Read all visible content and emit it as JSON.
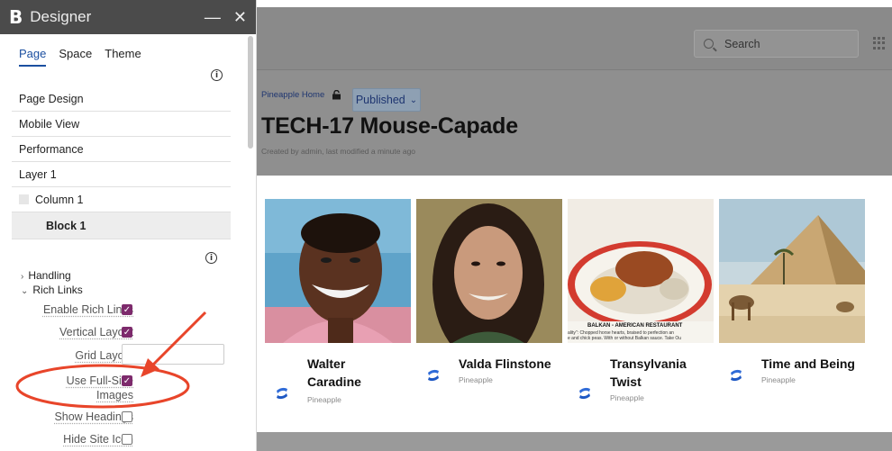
{
  "panel": {
    "title": "Designer",
    "logo": "B",
    "minimize_icon": "—",
    "close_icon": "✕",
    "tabs": [
      {
        "label": "Page",
        "active": true
      },
      {
        "label": "Space",
        "active": false
      },
      {
        "label": "Theme",
        "active": false
      }
    ],
    "info": "i",
    "items": [
      {
        "label": "Page Design"
      },
      {
        "label": "Mobile View"
      },
      {
        "label": "Performance"
      },
      {
        "label": "Layer 1"
      },
      {
        "label": "Column 1"
      },
      {
        "label": "Block 1"
      }
    ],
    "handling_label": "Handling",
    "rich_links_label": "Rich Links",
    "settings": {
      "enable_rich_links": {
        "label": "Enable Rich Links",
        "checked": true
      },
      "vertical_layout": {
        "label": "Vertical Layout",
        "checked": true
      },
      "grid_layout": {
        "label": "Grid Layout",
        "value": ""
      },
      "use_full_size_images": {
        "label_line1": "Use Full-Size",
        "label_line2": "Images",
        "checked": true
      },
      "show_headings": {
        "label": "Show Headings",
        "checked": false
      },
      "hide_site_icon": {
        "label": "Hide Site Icon",
        "checked": false
      }
    }
  },
  "header": {
    "search_placeholder": "Search"
  },
  "page": {
    "breadcrumb": "Pineapple Home",
    "status_label": "Published",
    "status_caret": "⌄",
    "title": "TECH-17 Mouse-Capade",
    "meta": "Created by admin, last modified a minute ago"
  },
  "cards": [
    {
      "name_line1": "Walter",
      "name_line2": "Caradine",
      "space": "Pineapple"
    },
    {
      "name_line1": "Valda Flinstone",
      "name_line2": "",
      "space": "Pineapple"
    },
    {
      "name_line1": "Transylvania",
      "name_line2": "Twist",
      "space": "Pineapple",
      "image_caption_1": "BALKAN - AMERICAN RESTAURANT",
      "image_caption_2": "ality\": Chopped horse hearts, braised to perfection an",
      "image_caption_3": "e and chick peas. With or without Balkan sauce. Take Ou"
    },
    {
      "name_line1": "Time and Being",
      "name_line2": "",
      "space": "Pineapple"
    }
  ],
  "colors": {
    "accent_tab": "#1b4fa0",
    "checkbox": "#7d2a6c",
    "annotation": "#e8452a",
    "overlay": "#8f8f8f"
  }
}
